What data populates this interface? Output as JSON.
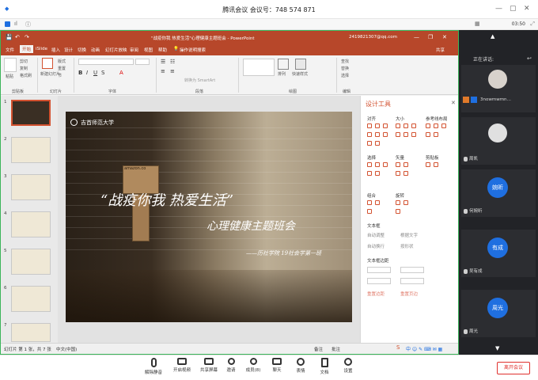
{
  "meeting": {
    "title": "腾讯会议  会议号：748 574 871",
    "time": "03:50",
    "speaking_label": "正在讲话:",
    "participants": [
      {
        "name": "3nowmwmn…",
        "initials": ""
      },
      {
        "name": "周凯",
        "initials": ""
      },
      {
        "name": "何婉昕",
        "initials": "婉昕"
      },
      {
        "name": "吴有成",
        "initials": "有成"
      },
      {
        "name": "周光",
        "initials": "周光"
      }
    ],
    "toolbar": [
      {
        "label": "解除静音",
        "icon": "mic-muted-icon"
      },
      {
        "label": "开启视频",
        "icon": "camera-off-icon"
      },
      {
        "label": "共享屏幕",
        "icon": "share-screen-icon"
      },
      {
        "label": "邀请",
        "icon": "invite-icon"
      },
      {
        "label": "成员(8)",
        "icon": "members-icon"
      },
      {
        "label": "聊天",
        "icon": "chat-icon"
      },
      {
        "label": "表情",
        "icon": "emoji-icon"
      },
      {
        "label": "文档",
        "icon": "doc-icon"
      },
      {
        "label": "设置",
        "icon": "settings-icon"
      }
    ],
    "leave_label": "离开会议"
  },
  "ppt": {
    "window_title": "\"战疫你我 热爱生活\"心理健康主题班会 - PowerPoint",
    "account": "2419821307@qq.com",
    "share_label": "共享",
    "tabs": [
      "文件",
      "开始",
      "iSlide",
      "插入",
      "设计",
      "切换",
      "动画",
      "幻灯片放映",
      "审阅",
      "视图",
      "帮助",
      "操作说明搜索"
    ],
    "ribbon_groups": [
      "剪贴板",
      "幻灯片",
      "字体",
      "段落",
      "绘图",
      "编辑"
    ],
    "ribbon_items": {
      "paste": "粘贴",
      "cut": "剪切",
      "copy": "复制",
      "format_painter": "格式刷",
      "new_slide": "新建幻灯片",
      "layout": "版式",
      "reset": "重置",
      "section": "节",
      "smartart": "转换为 SmartArt",
      "arrange": "排列",
      "quick_styles": "快速样式",
      "find": "查找",
      "replace": "替换",
      "select": "选择"
    },
    "slide_count": [
      1,
      2,
      3,
      4,
      5,
      6,
      7
    ],
    "status": {
      "left": "幻灯片 第 1 张，共 7 张",
      "lang": "中文(中国)",
      "notes": "备注",
      "comments": "批注"
    },
    "slide": {
      "school": "吉首师范大学",
      "main_title": "“战疫你我  热爱生活”",
      "sub_title": "心理健康主题班会",
      "byline": "——历社学院 19社会学第一班",
      "box_label": "amazon.co"
    },
    "design_panel": {
      "title": "设计工具",
      "sections": [
        "对齐",
        "大小",
        "参考线布局",
        "选择",
        "矢量",
        "剪贴板",
        "组合",
        "旋转",
        "文本框",
        "文本框边距"
      ],
      "radio_a": "自动调整",
      "radio_b": "根据文字",
      "radio_c": "自动换行",
      "radio_d": "按形状",
      "buttons": [
        "重置边距",
        "重置页边"
      ]
    }
  },
  "colors": {
    "ppt_red": "#b7472a",
    "meeting_blue": "#1f6fe0",
    "leave_red": "#e0302d"
  }
}
